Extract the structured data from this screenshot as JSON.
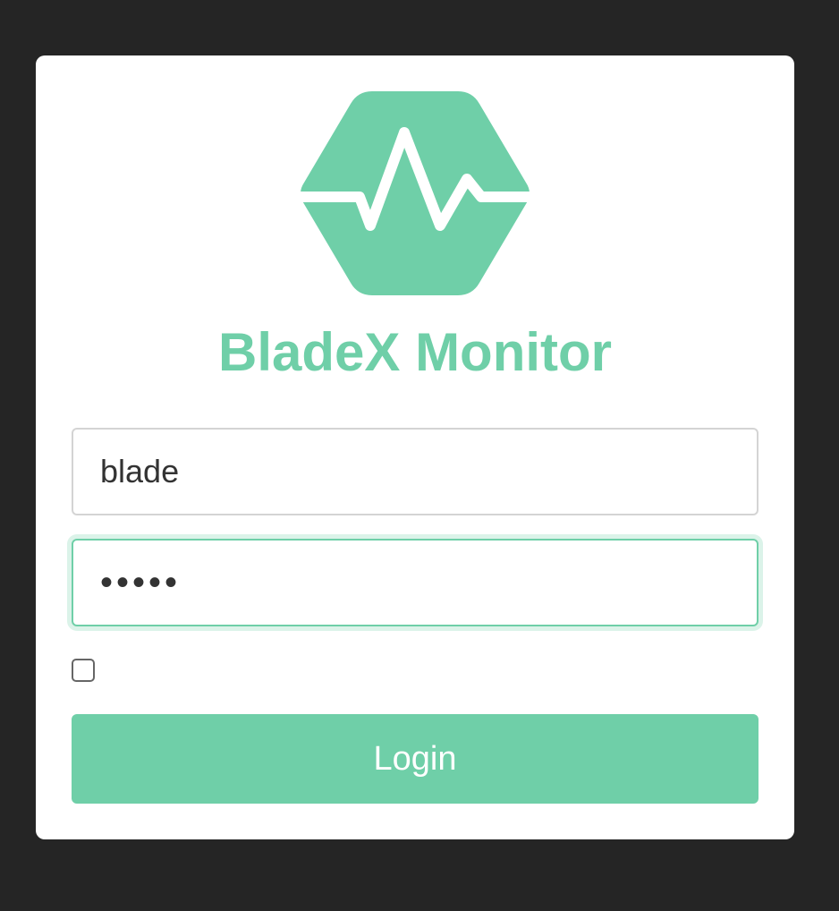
{
  "app": {
    "title": "BladeX Monitor",
    "brand_color": "#6fcfa8",
    "logo_icon": "heartbeat-hexagon-icon"
  },
  "form": {
    "username_value": "blade",
    "password_mask": "•••••",
    "remember_checked": false,
    "login_label": "Login"
  }
}
